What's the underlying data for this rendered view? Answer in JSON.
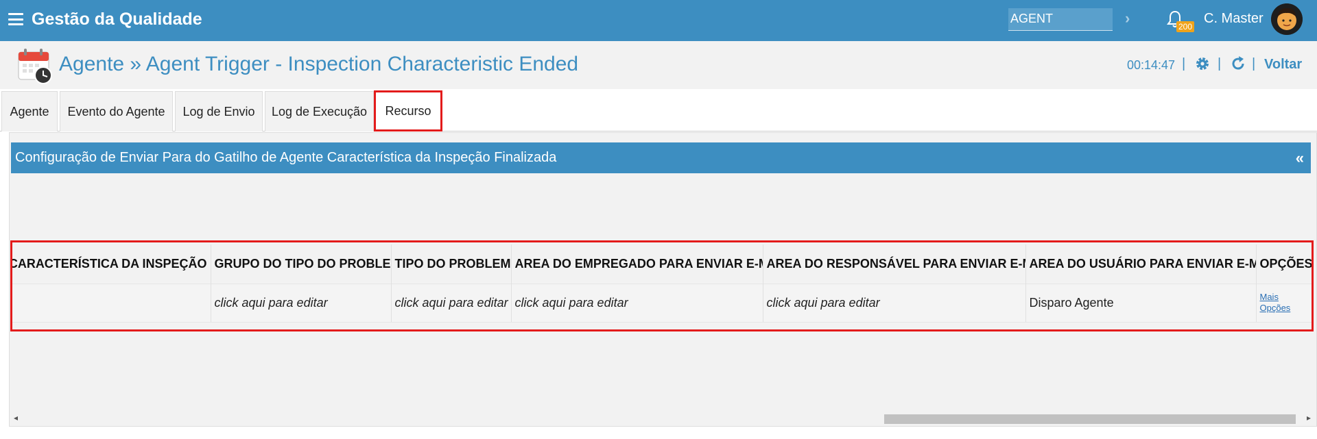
{
  "app": {
    "title": "Gestão da Qualidade",
    "search_value": "AGENT",
    "notification_count": "200",
    "user": "C. Master"
  },
  "page": {
    "title": "Agente » Agent Trigger - Inspection Characteristic Ended",
    "timer": "00:14:47",
    "back_label": "Voltar"
  },
  "tabs": [
    {
      "label": "Agente"
    },
    {
      "label": "Evento do Agente"
    },
    {
      "label": "Log de Envio"
    },
    {
      "label": "Log de Execução"
    },
    {
      "label": "Recurso"
    }
  ],
  "panel": {
    "title": "Configuração de Enviar Para do Gatilho de Agente Característica da Inspeção Finalizada",
    "collapse_glyph": "«"
  },
  "table": {
    "headers": [
      "DA CARACTERÍSTICA DA INSPEÇÃO",
      "GRUPO DO TIPO DO PROBLEMA",
      "TIPO DO PROBLEMA",
      "AREA DO EMPREGADO PARA ENVIAR E-MAIL",
      "AREA DO RESPONSÁVEL PARA ENVIAR E-MAIL",
      "AREA DO USUÁRIO PARA ENVIAR E-MAIL",
      "OPÇÕES"
    ],
    "row": [
      "",
      "click aqui para editar",
      "click aqui para editar",
      "click aqui para editar",
      "click aqui para editar",
      "Disparo Agente"
    ],
    "options_links": [
      "Mais",
      "Opções"
    ]
  },
  "colors": {
    "brand": "#3d8ec1",
    "highlight": "#e31b1b",
    "badge": "#f0a31a"
  },
  "icons": [
    "menu-icon",
    "chevron-right-icon",
    "bell-icon",
    "calendar-clock-icon",
    "gear-icon",
    "refresh-icon",
    "collapse-icon"
  ]
}
